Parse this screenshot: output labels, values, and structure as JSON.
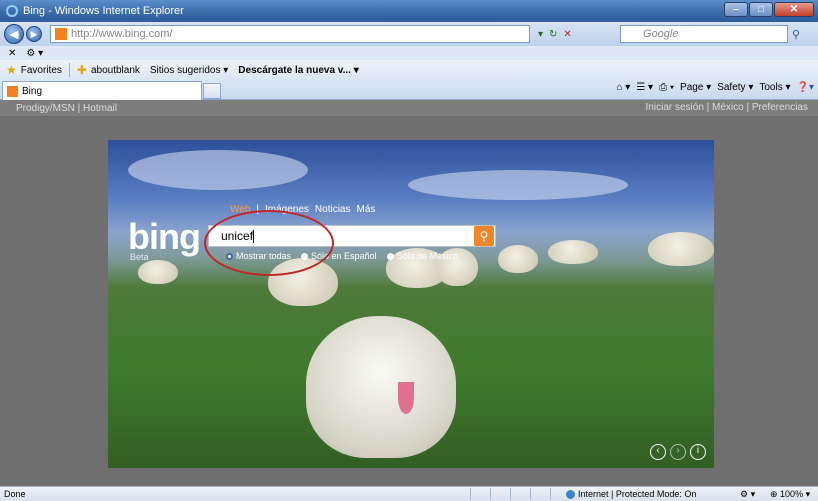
{
  "window": {
    "title": "Bing - Windows Internet Explorer"
  },
  "address": {
    "url": "http://www.bing.com/",
    "search_placeholder": "Google"
  },
  "favorites_bar": {
    "favorites": "Favorites",
    "items": [
      "aboutblank",
      "Sitios sugeridos ▾",
      "Descárgate la nueva v... ▾"
    ]
  },
  "tab": {
    "title": "Bing"
  },
  "toolbar": {
    "page": "Page ▾",
    "safety": "Safety ▾",
    "tools": "Tools ▾"
  },
  "bing_topnav": {
    "left": "Prodigy/MSN  |  Hotmail",
    "right": "Iniciar sesión  |  México  |  Preferencias"
  },
  "bing": {
    "logo": "bing",
    "beta": "Beta",
    "nav": [
      "Web",
      "Imágenes",
      "Noticias",
      "Más"
    ],
    "query": "unicef",
    "options": [
      "Mostrar todas",
      "Sólo en Español",
      "Sólo de México"
    ]
  },
  "status": {
    "left": "Done",
    "zone": "Internet | Protected Mode: On",
    "zoom": "100%"
  },
  "colors": {
    "accent": "#f0862b",
    "annotation_ring": "#c0282a"
  }
}
